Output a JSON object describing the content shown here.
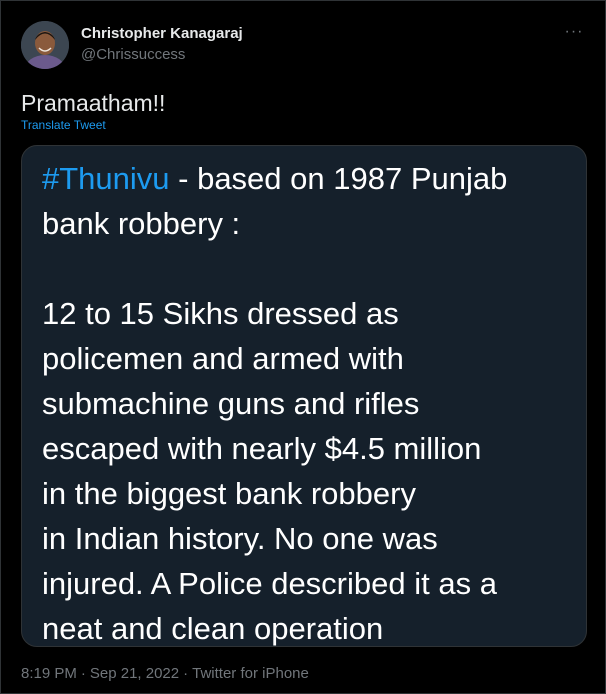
{
  "author": {
    "name": "Christopher Kanagaraj",
    "handle": "@Chrissuccess"
  },
  "more_icon": "ellipsis-icon",
  "tweet": {
    "text": "Pramaatham!!",
    "translate_label": "Translate Tweet"
  },
  "media": {
    "hashtag": "#Thunivu",
    "line1_rest": " - based on 1987 Punjab",
    "line2": "bank robbery :",
    "lines": [
      "12 to 15 Sikhs dressed as",
      "policemen and armed with",
      "submachine guns and rifles",
      "escaped with nearly $4.5 million",
      "in the biggest bank robbery",
      "in Indian history. No one was",
      "injured. A Police described it as a",
      "neat and clean operation"
    ]
  },
  "meta": {
    "time": "8:19 PM",
    "sep1": "·",
    "date": "Sep 21, 2022",
    "sep2": "·",
    "source": "Twitter for iPhone"
  },
  "colors": {
    "background": "#000000",
    "link": "#1d9bf0",
    "muted": "#71767b",
    "card": "#15202b"
  }
}
